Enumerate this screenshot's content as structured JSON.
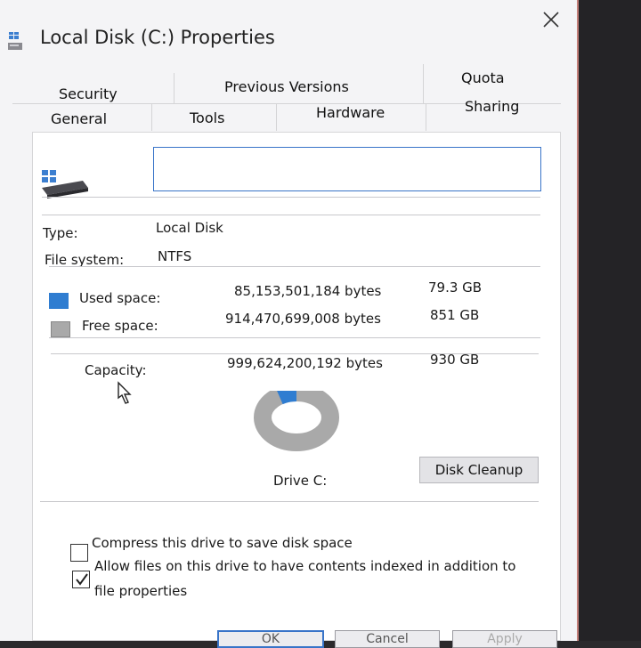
{
  "window": {
    "title": "Local Disk (C:) Properties",
    "close_label": "close"
  },
  "tabs": {
    "security": "Security",
    "previous_versions": "Previous Versions",
    "quota": "Quota",
    "general": "General",
    "tools": "Tools",
    "hardware": "Hardware",
    "sharing": "Sharing"
  },
  "general": {
    "drive_name_value": "",
    "type_label": "Type:",
    "type_value": "Local Disk",
    "filesystem_label": "File system:",
    "filesystem_value": "NTFS",
    "used_label": "Used space:",
    "used_bytes": "85,153,501,184 bytes",
    "used_gb": "79.3 GB",
    "free_label": "Free space:",
    "free_bytes": "914,470,699,008 bytes",
    "free_gb": "851 GB",
    "capacity_label": "Capacity:",
    "capacity_bytes": "999,624,200,192 bytes",
    "capacity_gb": "930 GB",
    "used_fraction": 0.085,
    "drive_label": "Drive C:",
    "cleanup_button": "Disk Cleanup",
    "compress_label": "Compress this drive to save disk space",
    "compress_checked": false,
    "index_label_line1": "Allow files on this drive to have contents indexed in addition to",
    "index_label_line2": "file properties",
    "index_checked": true
  },
  "colors": {
    "used": "#2f7dd1",
    "free": "#a9a9a9",
    "accent": "#3874c8"
  },
  "footer": {
    "ok": "OK",
    "cancel": "Cancel",
    "apply": "Apply"
  }
}
